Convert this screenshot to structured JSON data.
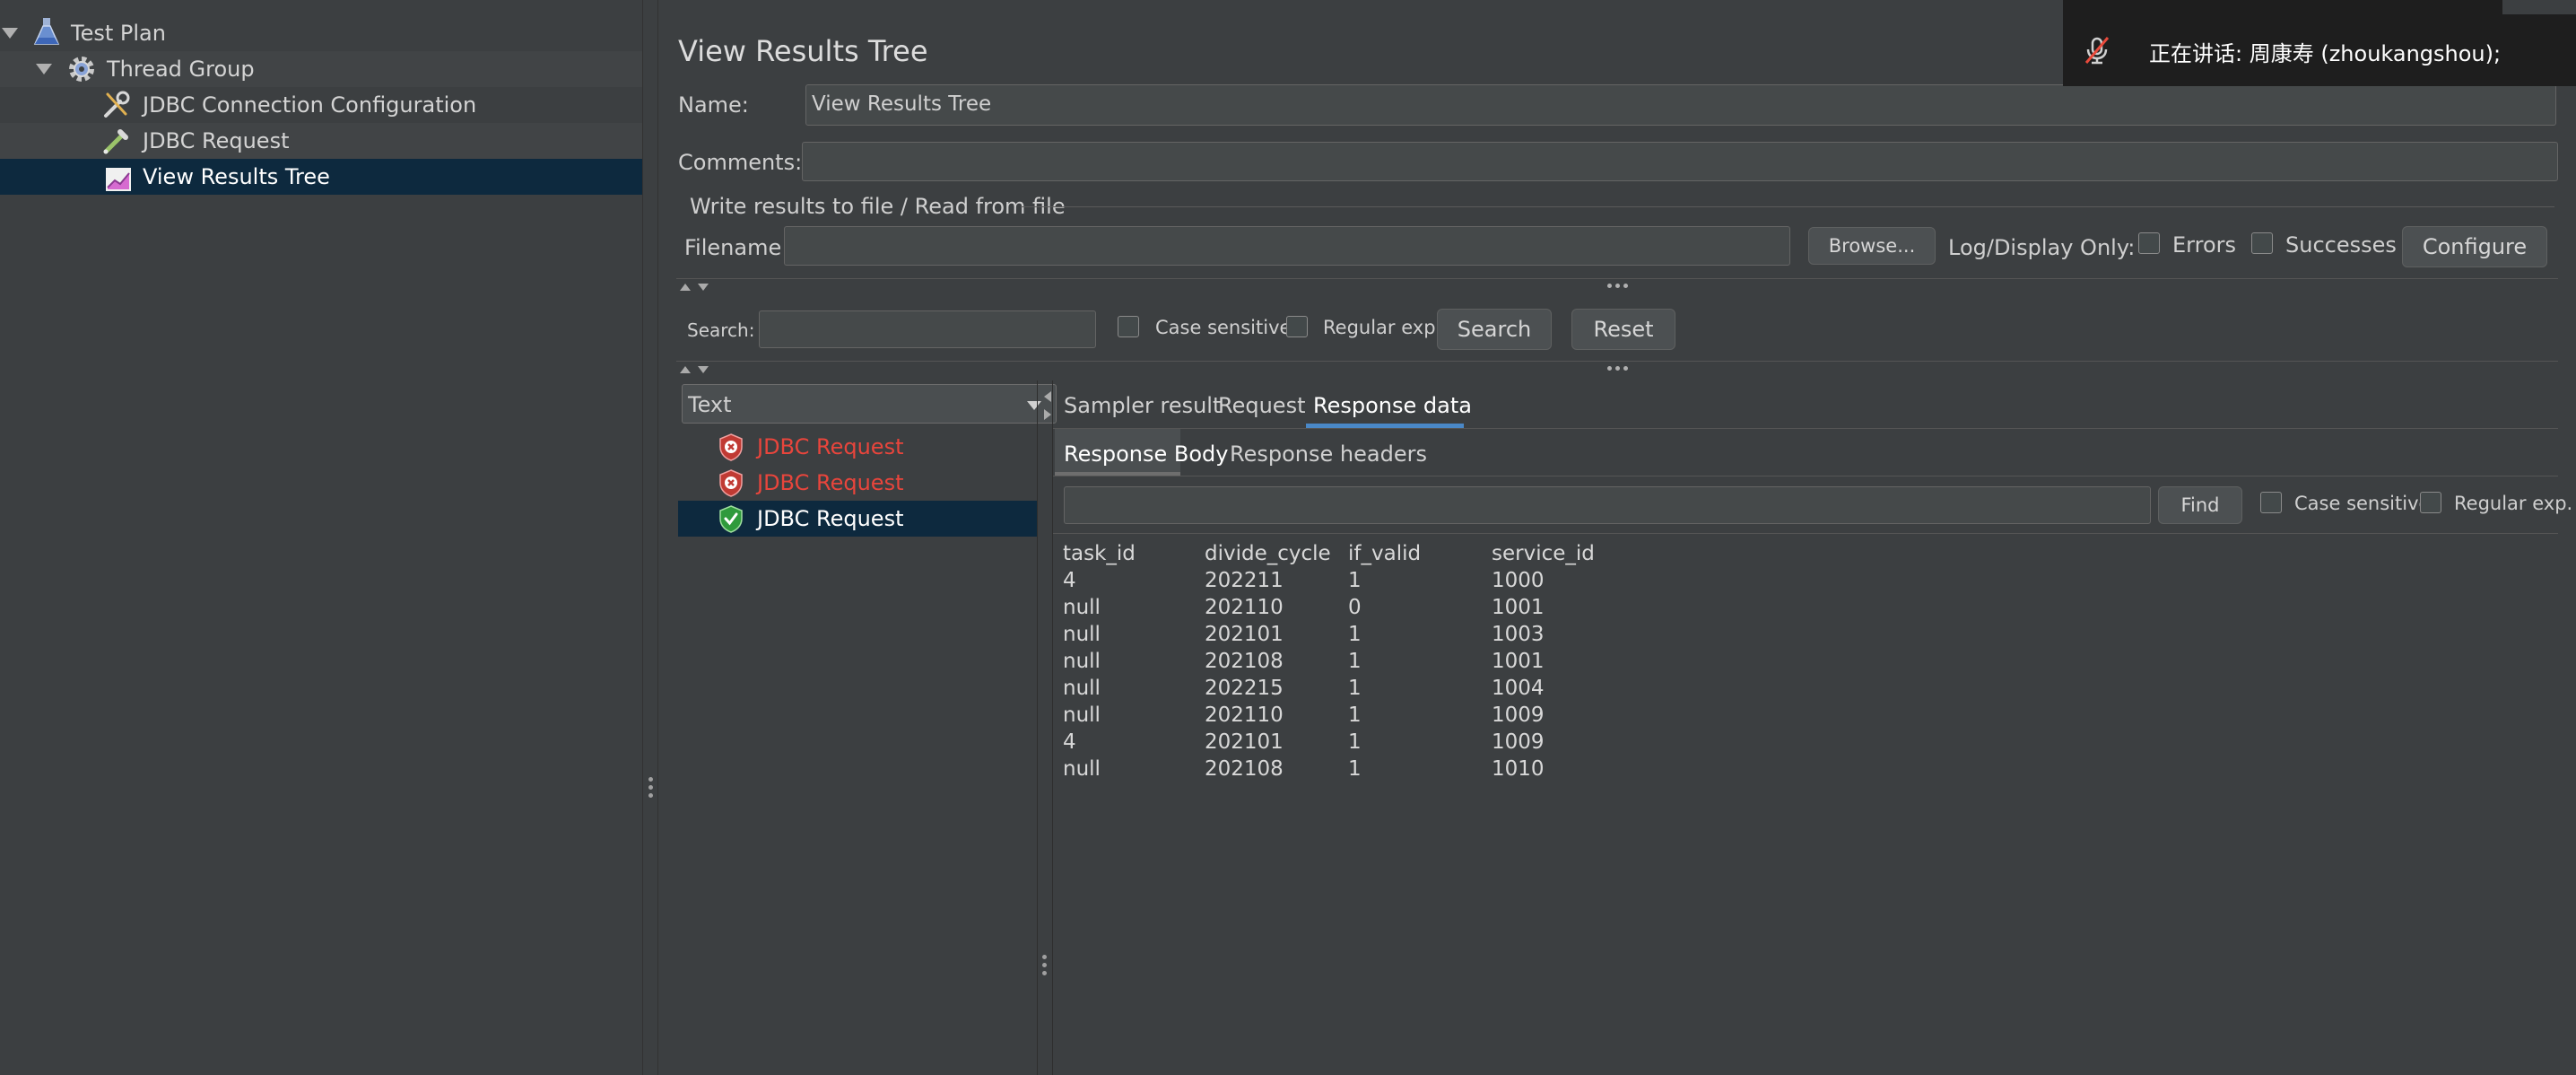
{
  "tree": {
    "items": [
      {
        "label": "Test Plan",
        "icon": "flask-icon"
      },
      {
        "label": "Thread Group",
        "icon": "gear-icon"
      },
      {
        "label": "JDBC Connection Configuration",
        "icon": "wrench-icon"
      },
      {
        "label": "JDBC Request",
        "icon": "pipette-icon"
      },
      {
        "label": "View Results Tree",
        "icon": "chart-icon"
      }
    ]
  },
  "panel": {
    "title": "View Results Tree",
    "name_label": "Name:",
    "name_value": "View Results Tree",
    "comments_label": "Comments:",
    "comments_value": "",
    "file_section_title": "Write results to file / Read from file",
    "filename_label": "Filename",
    "filename_value": "",
    "browse_label": "Browse...",
    "log_display_label": "Log/Display Only:",
    "errors_label": "Errors",
    "successes_label": "Successes",
    "configure_label": "Configure"
  },
  "search": {
    "label": "Search:",
    "value": "",
    "case_sensitive_label": "Case sensitive",
    "regex_label": "Regular exp.",
    "search_button": "Search",
    "reset_button": "Reset"
  },
  "renderer": {
    "selected": "Text"
  },
  "results": [
    {
      "label": "JDBC Request",
      "status": "error"
    },
    {
      "label": "JDBC Request",
      "status": "error"
    },
    {
      "label": "JDBC Request",
      "status": "success"
    }
  ],
  "tabs": {
    "items": [
      "Sampler result",
      "Request",
      "Response data"
    ],
    "active": "Response data"
  },
  "subtabs": {
    "items": [
      "Response Body",
      "Response headers"
    ],
    "active": "Response Body"
  },
  "find": {
    "value": "",
    "button": "Find",
    "case_sensitive_label": "Case sensitive",
    "regex_label": "Regular exp."
  },
  "response": {
    "columns": [
      "task_id",
      "divide_cycle",
      "if_valid",
      "service_id"
    ],
    "rows": [
      [
        "4",
        "202211",
        "1",
        "1000"
      ],
      [
        "null",
        "202110",
        "0",
        "1001"
      ],
      [
        "null",
        "202101",
        "1",
        "1003"
      ],
      [
        "null",
        "202108",
        "1",
        "1001"
      ],
      [
        "null",
        "202215",
        "1",
        "1004"
      ],
      [
        "null",
        "202110",
        "1",
        "1009"
      ],
      [
        "4",
        "202101",
        "1",
        "1009"
      ],
      [
        "null",
        "202108",
        "1",
        "1010"
      ]
    ]
  },
  "notification": {
    "text": "正在讲话: 周康寿 (zhoukangshou);",
    "icon": "muted-microphone-icon"
  },
  "colors": {
    "background": "#3c3f41",
    "selection": "#0d293e",
    "error_text": "#e8453c",
    "tab_accent": "#4a88c7"
  }
}
